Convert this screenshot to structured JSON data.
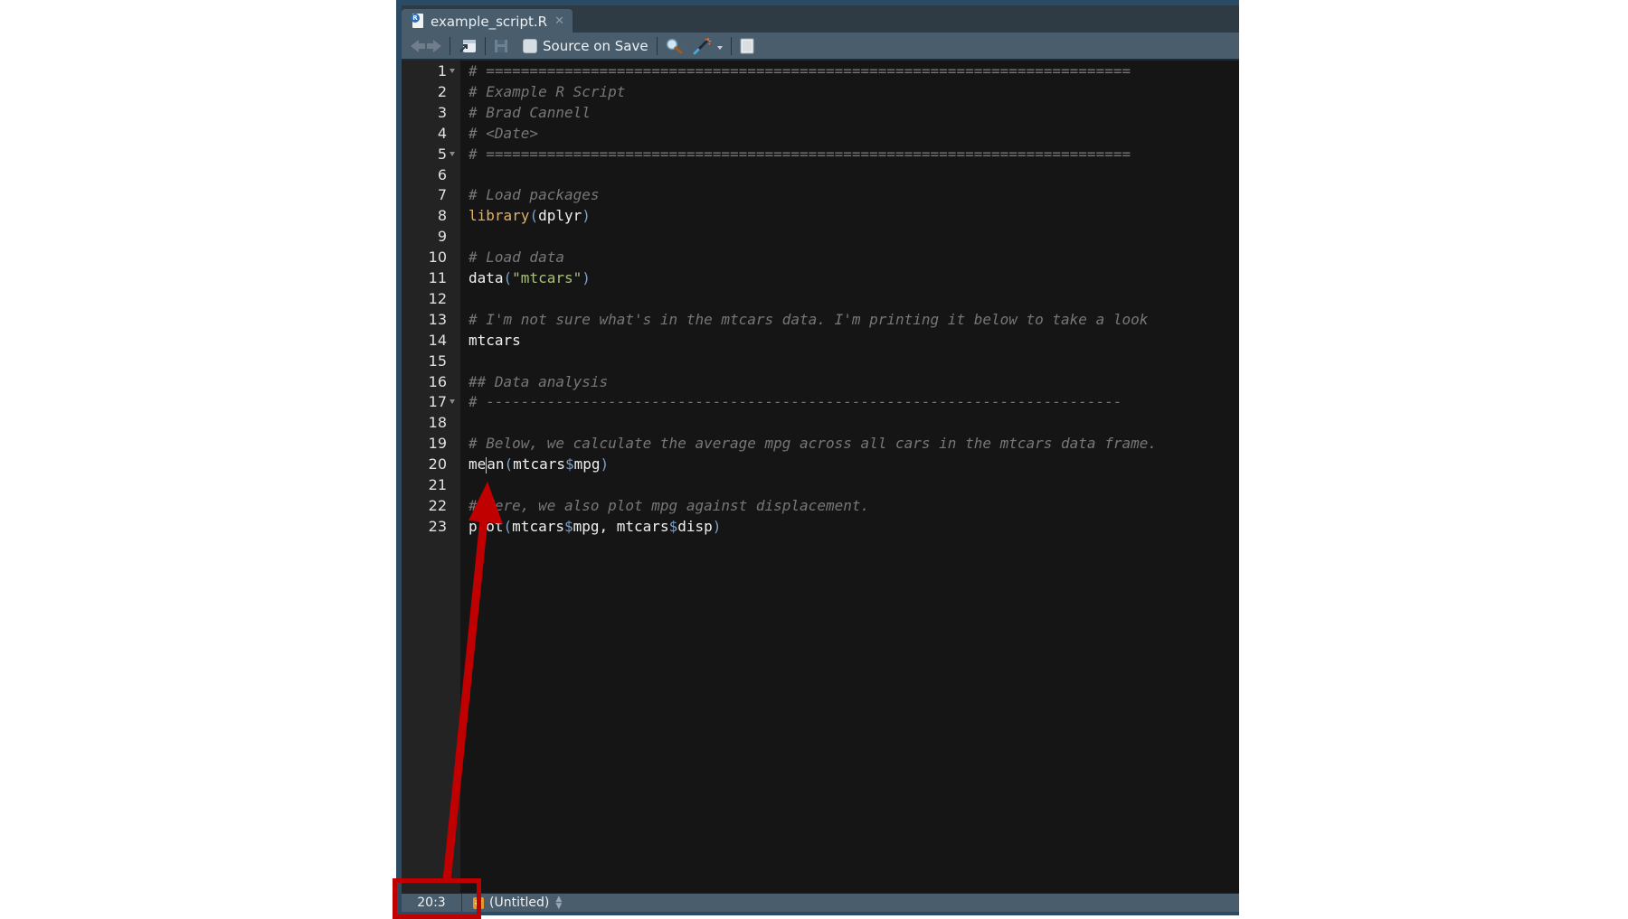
{
  "tab": {
    "file_icon": "r-script-file-icon",
    "filename": "example_script.R",
    "close_icon": "close-icon"
  },
  "toolbar": {
    "back_icon": "back-arrow-icon",
    "forward_icon": "forward-arrow-icon",
    "show_in_window_icon": "show-in-new-window-icon",
    "save_icon": "save-icon",
    "source_on_save_label": "Source on Save",
    "source_on_save_checked": false,
    "find_icon": "search-icon",
    "code_tools_icon": "magic-wand-icon",
    "compile_report_icon": "notebook-icon"
  },
  "editor": {
    "lines": [
      {
        "n": "1",
        "fold": true,
        "segments": [
          {
            "t": "# ==========================================================================",
            "c": "cm"
          }
        ]
      },
      {
        "n": "2",
        "fold": false,
        "segments": [
          {
            "t": "# Example R Script",
            "c": "cm"
          }
        ]
      },
      {
        "n": "3",
        "fold": false,
        "segments": [
          {
            "t": "# Brad Cannell",
            "c": "cm"
          }
        ]
      },
      {
        "n": "4",
        "fold": false,
        "segments": [
          {
            "t": "# <Date>",
            "c": "cm"
          }
        ]
      },
      {
        "n": "5",
        "fold": true,
        "segments": [
          {
            "t": "# ==========================================================================",
            "c": "cm"
          }
        ]
      },
      {
        "n": "6",
        "fold": false,
        "segments": []
      },
      {
        "n": "7",
        "fold": false,
        "segments": [
          {
            "t": "# Load packages",
            "c": "cm"
          }
        ]
      },
      {
        "n": "8",
        "fold": false,
        "segments": [
          {
            "t": "library",
            "c": "kw"
          },
          {
            "t": "(",
            "c": "paren"
          },
          {
            "t": "dplyr",
            "c": ""
          },
          {
            "t": ")",
            "c": "paren"
          }
        ]
      },
      {
        "n": "9",
        "fold": false,
        "segments": []
      },
      {
        "n": "10",
        "fold": false,
        "segments": [
          {
            "t": "# Load data",
            "c": "cm"
          }
        ]
      },
      {
        "n": "11",
        "fold": false,
        "segments": [
          {
            "t": "data",
            "c": ""
          },
          {
            "t": "(",
            "c": "paren"
          },
          {
            "t": "\"mtcars\"",
            "c": "str"
          },
          {
            "t": ")",
            "c": "paren"
          }
        ]
      },
      {
        "n": "12",
        "fold": false,
        "segments": []
      },
      {
        "n": "13",
        "fold": false,
        "segments": [
          {
            "t": "# I'm not sure what's in the mtcars data. I'm printing it below to take a look",
            "c": "cm"
          }
        ]
      },
      {
        "n": "14",
        "fold": false,
        "segments": [
          {
            "t": "mtcars",
            "c": ""
          }
        ]
      },
      {
        "n": "15",
        "fold": false,
        "segments": []
      },
      {
        "n": "16",
        "fold": false,
        "segments": [
          {
            "t": "## Data analysis",
            "c": "cm"
          }
        ]
      },
      {
        "n": "17",
        "fold": true,
        "segments": [
          {
            "t": "# -------------------------------------------------------------------------",
            "c": "cm"
          }
        ]
      },
      {
        "n": "18",
        "fold": false,
        "segments": []
      },
      {
        "n": "19",
        "fold": false,
        "segments": [
          {
            "t": "# Below, we calculate the average mpg across all cars in the mtcars data frame.",
            "c": "cm"
          }
        ]
      },
      {
        "n": "20",
        "fold": false,
        "cursor_after": 2,
        "segments": [
          {
            "t": "me",
            "c": ""
          },
          {
            "t": "CURSOR",
            "c": "cursor"
          },
          {
            "t": "an",
            "c": ""
          },
          {
            "t": "(",
            "c": "paren"
          },
          {
            "t": "mtcars",
            "c": ""
          },
          {
            "t": "$",
            "c": "dollar"
          },
          {
            "t": "mpg",
            "c": ""
          },
          {
            "t": ")",
            "c": "paren"
          }
        ]
      },
      {
        "n": "21",
        "fold": false,
        "segments": []
      },
      {
        "n": "22",
        "fold": false,
        "segments": [
          {
            "t": "# Here, we also plot mpg against displacement.",
            "c": "cm"
          }
        ]
      },
      {
        "n": "23",
        "fold": false,
        "segments": [
          {
            "t": "plot",
            "c": ""
          },
          {
            "t": "(",
            "c": "paren"
          },
          {
            "t": "mtcars",
            "c": ""
          },
          {
            "t": "$",
            "c": "dollar"
          },
          {
            "t": "mpg, mtcars",
            "c": ""
          },
          {
            "t": "$",
            "c": "dollar"
          },
          {
            "t": "disp",
            "c": ""
          },
          {
            "t": ")",
            "c": "paren"
          }
        ]
      }
    ]
  },
  "statusbar": {
    "cursor_position": "20:3",
    "scope_icon": "hash-section-icon",
    "scope_label": "(Untitled)",
    "scope_dropdown_icon": "up-down-chevron-icon"
  },
  "annotation": {
    "highlight_color": "#c00000",
    "highlighted_element": "cursor-position-indicator",
    "arrow_points_to": "text-cursor"
  }
}
